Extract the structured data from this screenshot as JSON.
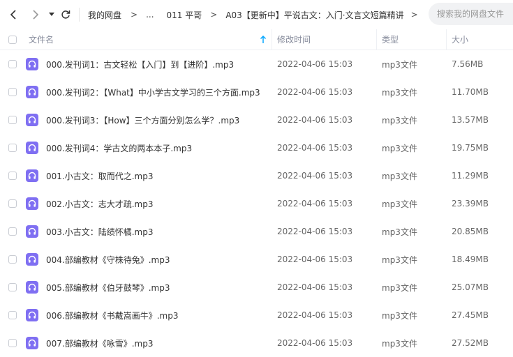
{
  "nav": {
    "back_icon": "chevron-left-icon",
    "forward_icon": "chevron-right-icon",
    "history_icon": "caret-down-icon",
    "refresh_icon": "refresh-icon"
  },
  "breadcrumb": {
    "items": [
      "我的网盘",
      "...",
      "011 平哥",
      "A03【更新中】平说古文：入门·文言文短篇精讲"
    ],
    "separator": ">"
  },
  "search": {
    "placeholder": "搜索我的网盘文件"
  },
  "table": {
    "headers": {
      "name": "文件名",
      "time": "修改时间",
      "type": "类型",
      "size": "大小"
    },
    "sort_icon": "sort-ascending-icon",
    "accent_color": "#06a7ff",
    "file_icon_color": "#7f6ff2",
    "rows": [
      {
        "name": "000.发刊词1：古文轻松【入门】到【进阶】.mp3",
        "time": "2022-04-06 15:03",
        "type": "mp3文件",
        "size": "7.56MB"
      },
      {
        "name": "000.发刊词2：【What】中小学古文学习的三个方面.mp3",
        "time": "2022-04-06 15:03",
        "type": "mp3文件",
        "size": "11.70MB"
      },
      {
        "name": "000.发刊词3：【How】三个方面分别怎么学？.mp3",
        "time": "2022-04-06 15:03",
        "type": "mp3文件",
        "size": "13.57MB"
      },
      {
        "name": "000.发刊词4：学古文的两本本子.mp3",
        "time": "2022-04-06 15:03",
        "type": "mp3文件",
        "size": "19.75MB"
      },
      {
        "name": "001.小古文：取而代之.mp3",
        "time": "2022-04-06 15:03",
        "type": "mp3文件",
        "size": "11.29MB"
      },
      {
        "name": "002.小古文：志大才疏.mp3",
        "time": "2022-04-06 15:03",
        "type": "mp3文件",
        "size": "23.39MB"
      },
      {
        "name": "003.小古文：陆绩怀橘.mp3",
        "time": "2022-04-06 15:03",
        "type": "mp3文件",
        "size": "20.85MB"
      },
      {
        "name": "004.部编教材《守株待兔》.mp3",
        "time": "2022-04-06 15:03",
        "type": "mp3文件",
        "size": "18.49MB"
      },
      {
        "name": "005.部编教材《伯牙鼓琴》.mp3",
        "time": "2022-04-06 15:03",
        "type": "mp3文件",
        "size": "25.07MB"
      },
      {
        "name": "006.部编教材《书戴嵩画牛》.mp3",
        "time": "2022-04-06 15:03",
        "type": "mp3文件",
        "size": "27.45MB"
      },
      {
        "name": "007.部编教材《咏雪》.mp3",
        "time": "2022-04-06 15:03",
        "type": "mp3文件",
        "size": "27.52MB"
      }
    ]
  }
}
